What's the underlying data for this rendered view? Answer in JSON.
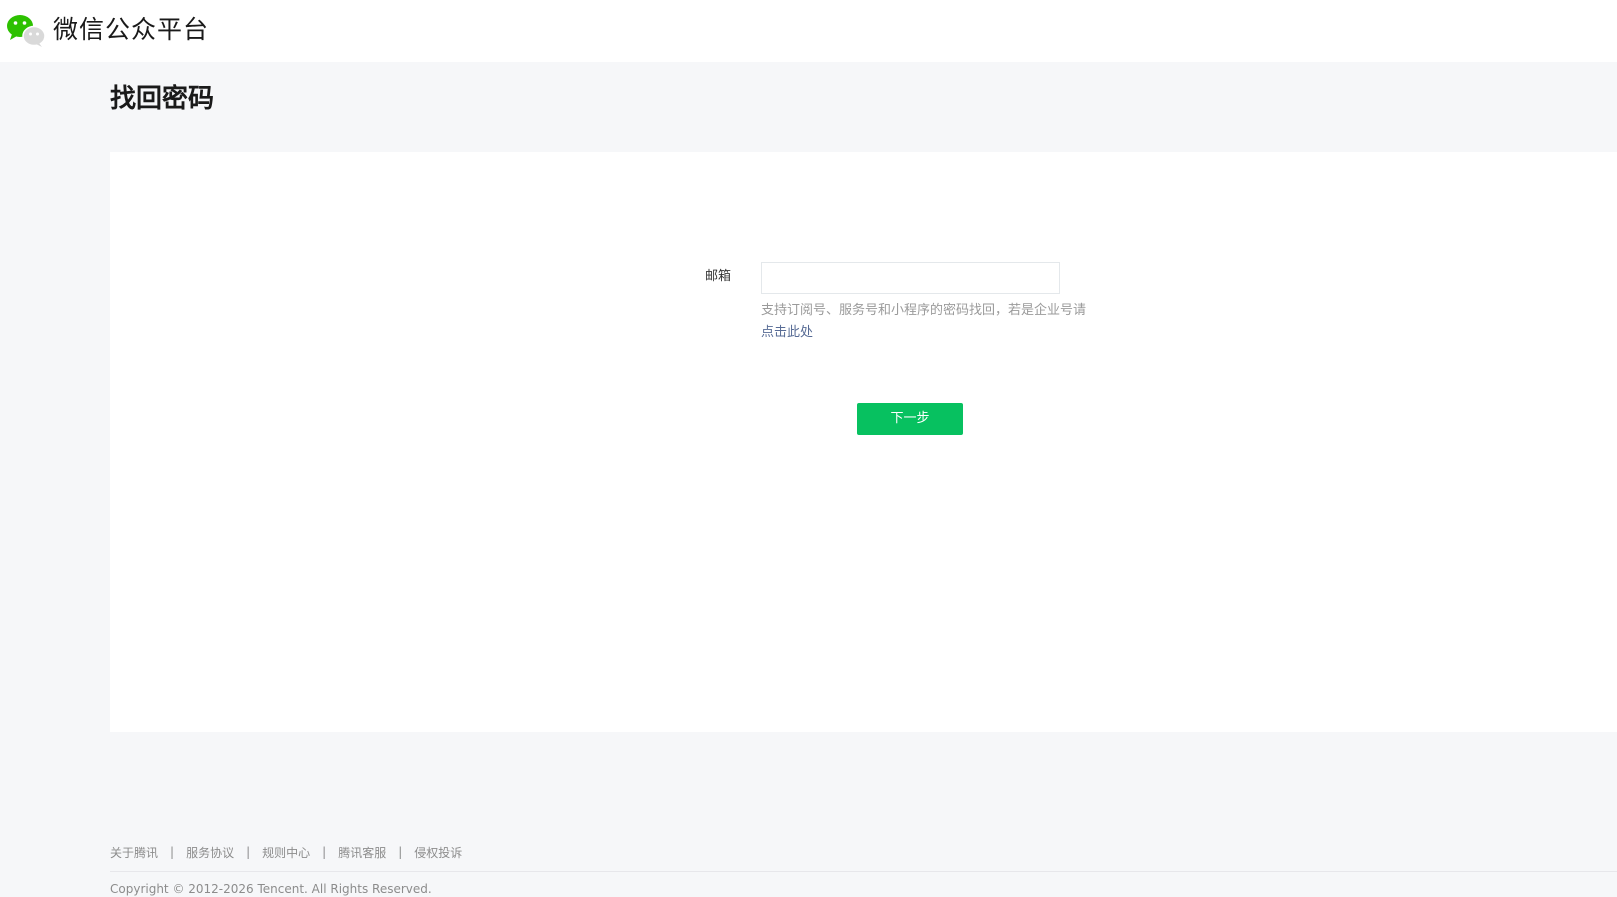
{
  "header": {
    "logo_icon": "wechat-icon",
    "logo_text": "微信公众平台"
  },
  "page": {
    "title": "找回密码"
  },
  "form": {
    "email_label": "邮箱",
    "email_value": "",
    "hint_text": "支持订阅号、服务号和小程序的密码找回，若是企业号请",
    "hint_link": "点击此处",
    "next_button": "下一步"
  },
  "footer": {
    "links": [
      "关于腾讯",
      "服务协议",
      "规则中心",
      "腾讯客服",
      "侵权投诉"
    ],
    "separator": "|",
    "copyright": "Copyright © 2012-2026 Tencent. All Rights Reserved."
  },
  "colors": {
    "primary_green": "#07c160",
    "link_blue": "#576b95",
    "page_bg": "#f6f7f9"
  }
}
